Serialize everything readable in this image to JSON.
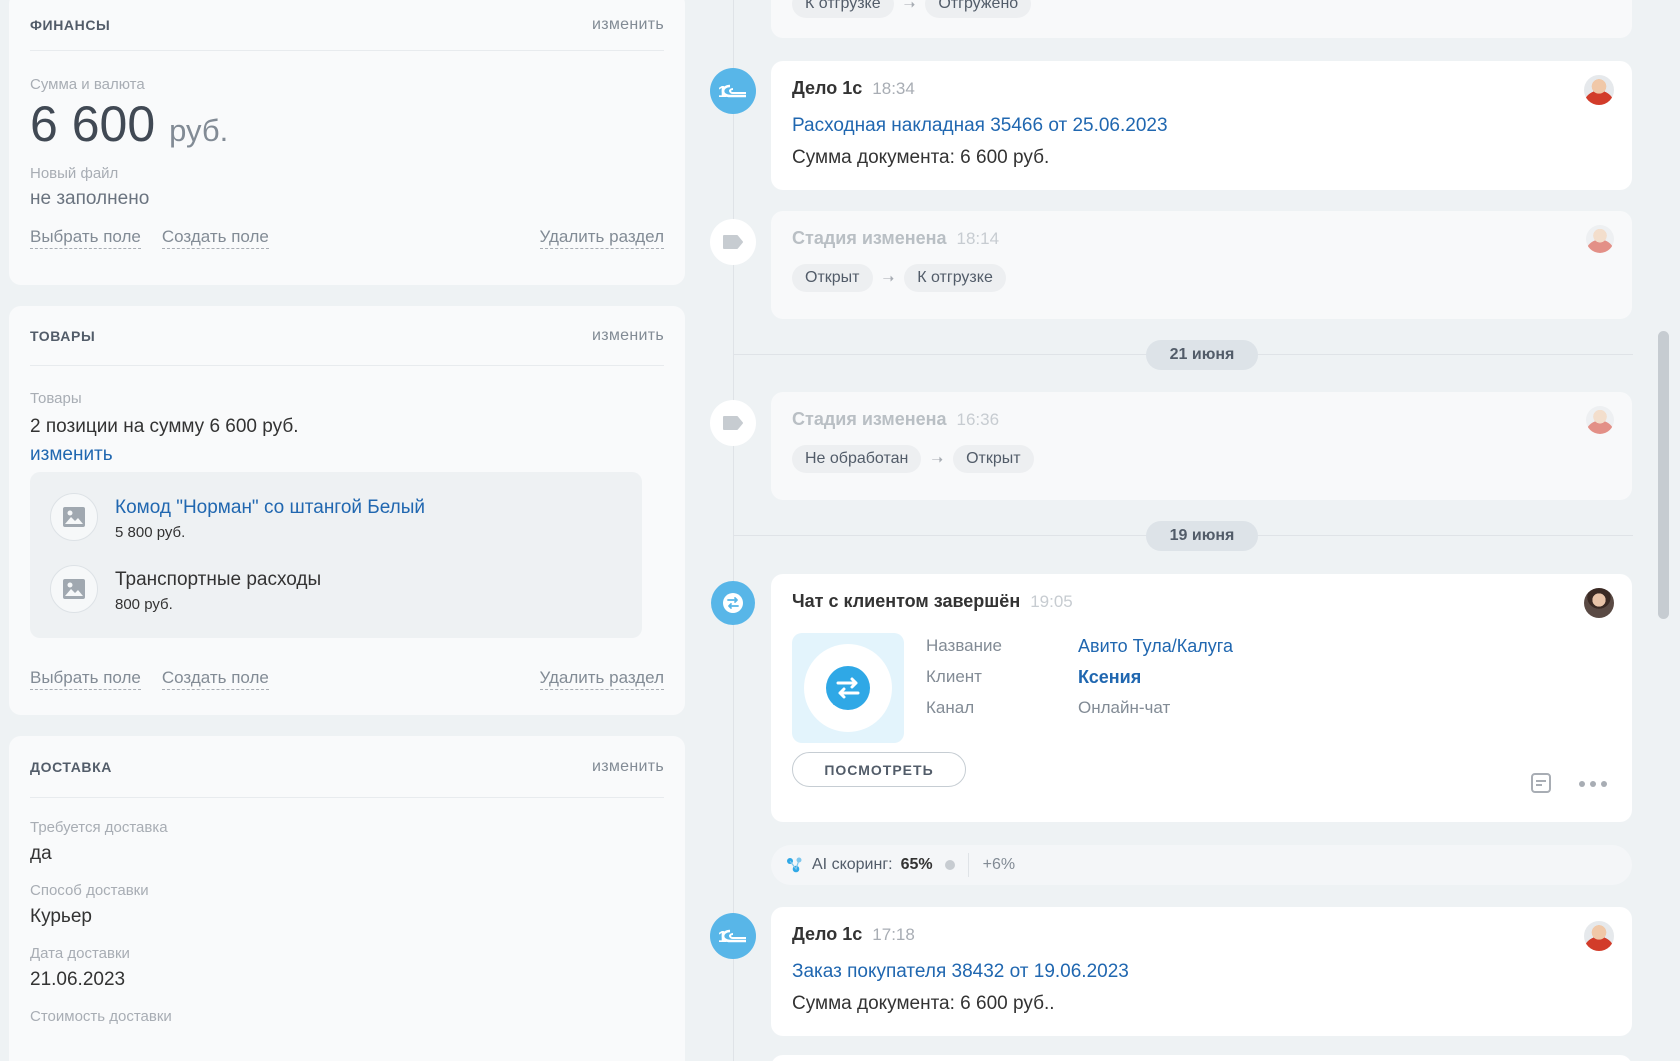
{
  "finance": {
    "title": "ФИНАНСЫ",
    "edit": "изменить",
    "sum_label": "Сумма и валюта",
    "sum_value": "6 600",
    "currency": "руб.",
    "file_label": "Новый файл",
    "file_value": "не заполнено",
    "choose_field": "Выбрать поле",
    "create_field": "Создать поле",
    "delete_section": "Удалить раздел"
  },
  "goods": {
    "title": "ТОВАРЫ",
    "edit": "изменить",
    "label": "Товары",
    "summary": "2 позиции на сумму 6 600 руб.",
    "change_link": "изменить",
    "items": [
      {
        "name": "Комод \"Норман\" со штангой Белый",
        "price": "5 800 руб.",
        "is_link": true
      },
      {
        "name": "Транспортные расходы",
        "price": "800 руб.",
        "is_link": false
      }
    ],
    "choose_field": "Выбрать поле",
    "create_field": "Создать поле",
    "delete_section": "Удалить раздел"
  },
  "delivery": {
    "title": "ДОСТАВКА",
    "edit": "изменить",
    "fields": [
      {
        "label": "Требуется доставка",
        "value": "да"
      },
      {
        "label": "Способ доставки",
        "value": "Курьер"
      },
      {
        "label": "Дата доставки",
        "value": "21.06.2023"
      },
      {
        "label": "Стоимость доставки",
        "value": ""
      }
    ]
  },
  "timeline": {
    "top_chips": [
      "К отгрузке",
      "Отгружено"
    ],
    "date_june21": "21 июня",
    "date_june19": "19 июня",
    "event1": {
      "title": "Дело 1с",
      "time": "18:34",
      "link": "Расходная накладная 35466 от 25.06.2023",
      "text": "Сумма документа: 6 600 руб."
    },
    "event2": {
      "title": "Стадия изменена",
      "time": "18:14",
      "from": "Открыт",
      "to": "К отгрузке"
    },
    "event3": {
      "title": "Стадия изменена",
      "time": "16:36",
      "from": "Не обработан",
      "to": "Открыт"
    },
    "event4": {
      "title": "Чат с клиентом завершён",
      "time": "19:05",
      "name_label": "Название",
      "name_value": "Авито Тула/Калуга",
      "client_label": "Клиент",
      "client_value": "Ксения",
      "channel_label": "Канал",
      "channel_value": "Онлайн-чат",
      "view_button": "ПОСМОТРЕТЬ"
    },
    "ai_scoring": {
      "label": "AI скоринг:",
      "value": "65%",
      "delta": "+6%"
    },
    "event5": {
      "title": "Дело 1с",
      "time": "17:18",
      "link": "Заказ покупателя 38432 от 19.06.2023",
      "text": "Сумма документа: 6 600 руб.."
    }
  },
  "colors": {
    "accent_blue": "#2067b0",
    "icon_blue": "#58b6e8",
    "background": "#eef2f4"
  }
}
